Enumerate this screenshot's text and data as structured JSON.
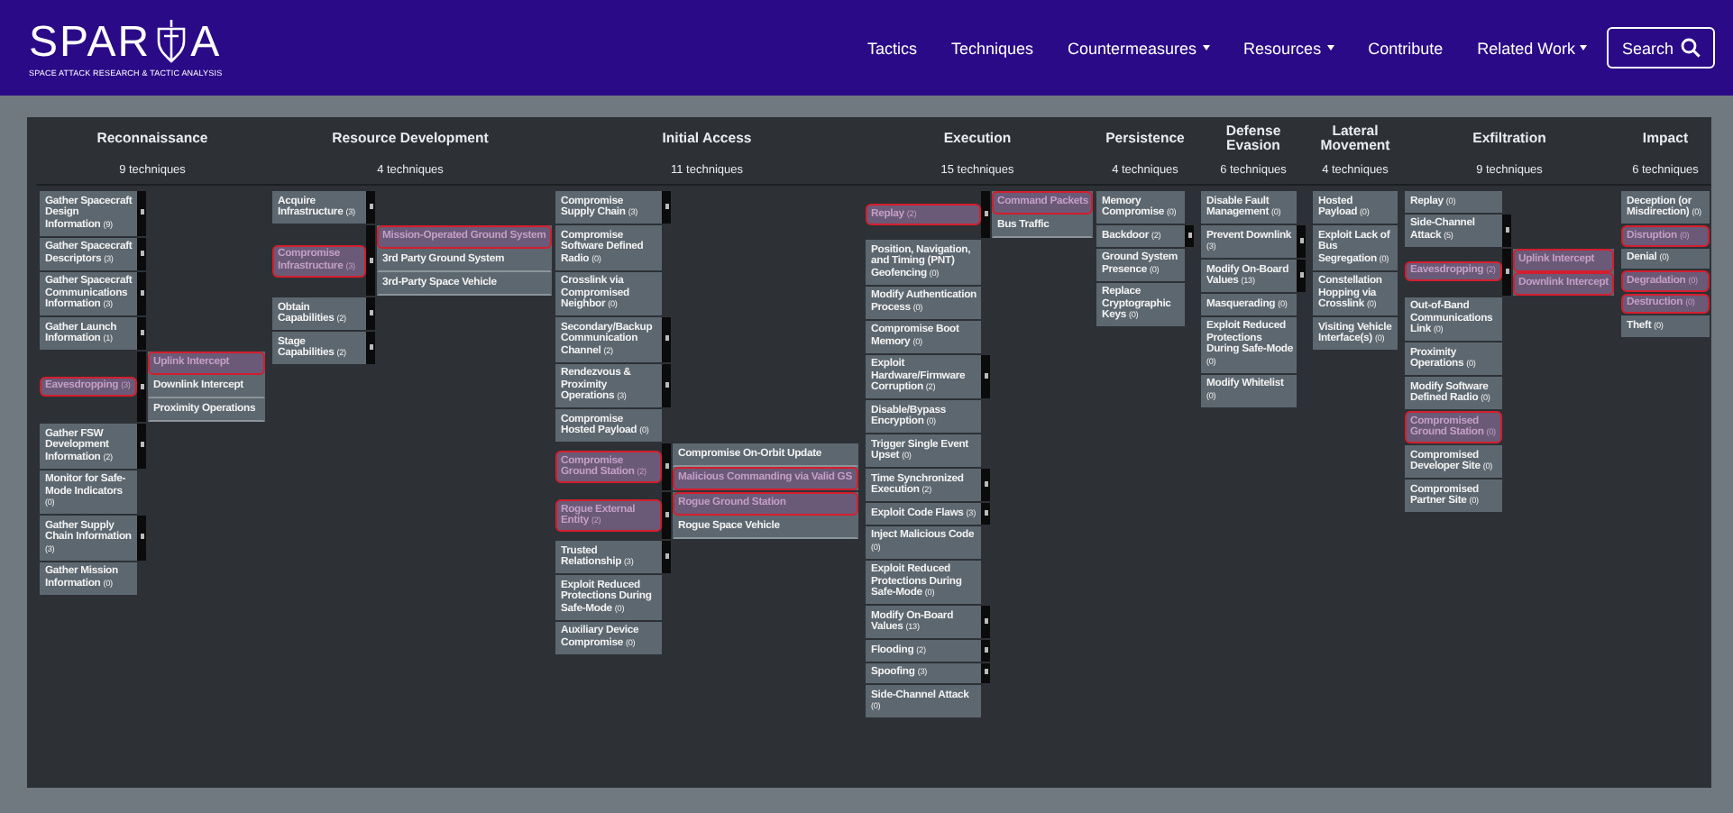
{
  "header": {
    "logo": {
      "wordmark_left": "SPAR",
      "wordmark_right": "A",
      "tagline": "SPACE ATTACK RESEARCH & TACTIC ANALYSIS"
    },
    "nav": [
      {
        "label": "Tactics",
        "has_menu": false
      },
      {
        "label": "Techniques",
        "has_menu": false
      },
      {
        "label": "Countermeasures",
        "has_menu": true
      },
      {
        "label": "Resources",
        "has_menu": true
      },
      {
        "label": "Contribute",
        "has_menu": false
      },
      {
        "label": "Related Work",
        "has_menu": true
      }
    ],
    "search_button": {
      "label": "Search"
    }
  },
  "tactics": [
    {
      "name": "Reconnaissance",
      "count": "9 techniques",
      "techniques": [
        {
          "name": "Gather Spacecraft Design Information",
          "count": "(9)",
          "has_subs": true,
          "highlighted": false
        },
        {
          "name": "Gather Spacecraft Descriptors",
          "count": "(3)",
          "has_subs": true,
          "highlighted": false
        },
        {
          "name": "Gather Spacecraft Communications Information",
          "count": "(3)",
          "has_subs": true,
          "highlighted": false
        },
        {
          "name": "Gather Launch Information",
          "count": "(1)",
          "has_subs": true,
          "highlighted": false
        },
        {
          "name": "Eavesdropping",
          "count": "(3)",
          "has_subs": true,
          "highlighted": true,
          "subtechniques": [
            {
              "name": "Uplink Intercept",
              "highlighted": true
            },
            {
              "name": "Downlink Intercept",
              "highlighted": false
            },
            {
              "name": "Proximity Operations",
              "highlighted": false
            }
          ]
        },
        {
          "name": "Gather FSW Development Information",
          "count": "(2)",
          "has_subs": true,
          "highlighted": false
        },
        {
          "name": "Monitor for Safe-Mode Indicators",
          "count": "(0)",
          "has_subs": false,
          "highlighted": false
        },
        {
          "name": "Gather Supply Chain Information",
          "count": "(3)",
          "has_subs": true,
          "highlighted": false
        },
        {
          "name": "Gather Mission Information",
          "count": "(0)",
          "has_subs": false,
          "highlighted": false
        }
      ]
    },
    {
      "name": "Resource Development",
      "count": "4 techniques",
      "techniques": [
        {
          "name": "Acquire Infrastructure",
          "count": "(3)",
          "has_subs": true,
          "highlighted": false
        },
        {
          "name": "Compromise Infrastructure",
          "count": "(3)",
          "has_subs": true,
          "highlighted": true,
          "subtechniques": [
            {
              "name": "Mission-Operated Ground System",
              "highlighted": true
            },
            {
              "name": "3rd Party Ground System",
              "highlighted": false
            },
            {
              "name": "3rd-Party Space Vehicle",
              "highlighted": false
            }
          ]
        },
        {
          "name": "Obtain Capabilities",
          "count": "(2)",
          "has_subs": true,
          "highlighted": false
        },
        {
          "name": "Stage Capabilities",
          "count": "(2)",
          "has_subs": true,
          "highlighted": false
        }
      ]
    },
    {
      "name": "Initial Access",
      "count": "11 techniques",
      "techniques": [
        {
          "name": "Compromise Supply Chain",
          "count": "(3)",
          "has_subs": true,
          "highlighted": false
        },
        {
          "name": "Compromise Software Defined Radio",
          "count": "(0)",
          "has_subs": false,
          "highlighted": false
        },
        {
          "name": "Crosslink via Compromised Neighbor",
          "count": "(0)",
          "has_subs": false,
          "highlighted": false
        },
        {
          "name": "Secondary/Backup Communication Channel",
          "count": "(2)",
          "has_subs": true,
          "highlighted": false
        },
        {
          "name": "Rendezvous & Proximity Operations",
          "count": "(3)",
          "has_subs": true,
          "highlighted": false
        },
        {
          "name": "Compromise Hosted Payload",
          "count": "(0)",
          "has_subs": false,
          "highlighted": false
        },
        {
          "name": "Compromise Ground Station",
          "count": "(2)",
          "has_subs": true,
          "highlighted": true,
          "subtechniques": [
            {
              "name": "Compromise On-Orbit Update",
              "highlighted": false
            },
            {
              "name": "Malicious Commanding via Valid GS",
              "highlighted": true
            }
          ]
        },
        {
          "name": "Rogue External Entity",
          "count": "(2)",
          "has_subs": true,
          "highlighted": true,
          "subtechniques": [
            {
              "name": "Rogue Ground Station",
              "highlighted": true
            },
            {
              "name": "Rogue Space Vehicle",
              "highlighted": false
            }
          ]
        },
        {
          "name": "Trusted Relationship",
          "count": "(3)",
          "has_subs": true,
          "highlighted": false
        },
        {
          "name": "Exploit Reduced Protections During Safe-Mode",
          "count": "(0)",
          "has_subs": false,
          "highlighted": false
        },
        {
          "name": "Auxiliary Device Compromise",
          "count": "(0)",
          "has_subs": false,
          "highlighted": false
        }
      ]
    },
    {
      "name": "Execution",
      "count": "15 techniques",
      "techniques": [
        {
          "name": "Replay",
          "count": "(2)",
          "has_subs": true,
          "highlighted": true,
          "subtechniques": [
            {
              "name": "Command Packets",
              "highlighted": true
            },
            {
              "name": "Bus Traffic",
              "highlighted": false
            }
          ]
        },
        {
          "name": "Position, Navigation, and Timing (PNT) Geofencing",
          "count": "(0)",
          "has_subs": false,
          "highlighted": false
        },
        {
          "name": "Modify Authentication Process",
          "count": "(0)",
          "has_subs": false,
          "highlighted": false
        },
        {
          "name": "Compromise Boot Memory",
          "count": "(0)",
          "has_subs": false,
          "highlighted": false
        },
        {
          "name": "Exploit Hardware/Firmware Corruption",
          "count": "(2)",
          "has_subs": true,
          "highlighted": false
        },
        {
          "name": "Disable/Bypass Encryption",
          "count": "(0)",
          "has_subs": false,
          "highlighted": false
        },
        {
          "name": "Trigger Single Event Upset",
          "count": "(0)",
          "has_subs": false,
          "highlighted": false
        },
        {
          "name": "Time Synchronized Execution",
          "count": "(2)",
          "has_subs": true,
          "highlighted": false
        },
        {
          "name": "Exploit Code Flaws",
          "count": "(3)",
          "has_subs": true,
          "highlighted": false
        },
        {
          "name": "Inject Malicious Code",
          "count": "(0)",
          "has_subs": false,
          "highlighted": false
        },
        {
          "name": "Exploit Reduced Protections During Safe-Mode",
          "count": "(0)",
          "has_subs": false,
          "highlighted": false
        },
        {
          "name": "Modify On-Board Values",
          "count": "(13)",
          "has_subs": true,
          "highlighted": false
        },
        {
          "name": "Flooding",
          "count": "(2)",
          "has_subs": true,
          "highlighted": false
        },
        {
          "name": "Spoofing",
          "count": "(3)",
          "has_subs": true,
          "highlighted": false
        },
        {
          "name": "Side-Channel Attack",
          "count": "(0)",
          "has_subs": false,
          "highlighted": false
        }
      ]
    },
    {
      "name": "Persistence",
      "count": "4 techniques",
      "techniques": [
        {
          "name": "Memory Compromise",
          "count": "(0)",
          "has_subs": false,
          "highlighted": false
        },
        {
          "name": "Backdoor",
          "count": "(2)",
          "has_subs": true,
          "highlighted": false
        },
        {
          "name": "Ground System Presence",
          "count": "(0)",
          "has_subs": false,
          "highlighted": false
        },
        {
          "name": "Replace Cryptographic Keys",
          "count": "(0)",
          "has_subs": false,
          "highlighted": false
        }
      ]
    },
    {
      "name": "Defense Evasion",
      "count": "6 techniques",
      "techniques": [
        {
          "name": "Disable Fault Management",
          "count": "(0)",
          "has_subs": false,
          "highlighted": false
        },
        {
          "name": "Prevent Downlink",
          "count": "(3)",
          "has_subs": true,
          "highlighted": false
        },
        {
          "name": "Modify On-Board Values",
          "count": "(13)",
          "has_subs": true,
          "highlighted": false
        },
        {
          "name": "Masquerading",
          "count": "(0)",
          "has_subs": false,
          "highlighted": false
        },
        {
          "name": "Exploit Reduced Protections During Safe-Mode",
          "count": "(0)",
          "has_subs": false,
          "highlighted": false
        },
        {
          "name": "Modify Whitelist",
          "count": "(0)",
          "has_subs": false,
          "highlighted": false
        }
      ]
    },
    {
      "name": "Lateral Movement",
      "count": "4 techniques",
      "techniques": [
        {
          "name": "Hosted Payload",
          "count": "(0)",
          "has_subs": false,
          "highlighted": false
        },
        {
          "name": "Exploit Lack of Bus Segregation",
          "count": "(0)",
          "has_subs": false,
          "highlighted": false
        },
        {
          "name": "Constellation Hopping via Crosslink",
          "count": "(0)",
          "has_subs": false,
          "highlighted": false
        },
        {
          "name": "Visiting Vehicle Interface(s)",
          "count": "(0)",
          "has_subs": false,
          "highlighted": false
        }
      ]
    },
    {
      "name": "Exfiltration",
      "count": "9 techniques",
      "techniques": [
        {
          "name": "Replay",
          "count": "(0)",
          "has_subs": false,
          "highlighted": false
        },
        {
          "name": "Side-Channel Attack",
          "count": "(5)",
          "has_subs": true,
          "highlighted": false
        },
        {
          "name": "Eavesdropping",
          "count": "(2)",
          "has_subs": true,
          "highlighted": true,
          "subtechniques": [
            {
              "name": "Uplink Intercept",
              "highlighted": true
            },
            {
              "name": "Downlink Intercept",
              "highlighted": true
            }
          ]
        },
        {
          "name": "Out-of-Band Communications Link",
          "count": "(0)",
          "has_subs": false,
          "highlighted": false
        },
        {
          "name": "Proximity Operations",
          "count": "(0)",
          "has_subs": false,
          "highlighted": false
        },
        {
          "name": "Modify Software Defined Radio",
          "count": "(0)",
          "has_subs": false,
          "highlighted": false
        },
        {
          "name": "Compromised Ground Station",
          "count": "(0)",
          "has_subs": false,
          "highlighted": true
        },
        {
          "name": "Compromised Developer Site",
          "count": "(0)",
          "has_subs": false,
          "highlighted": false
        },
        {
          "name": "Compromised Partner Site",
          "count": "(0)",
          "has_subs": false,
          "highlighted": false
        }
      ]
    },
    {
      "name": "Impact",
      "count": "6 techniques",
      "techniques": [
        {
          "name": "Deception (or Misdirection)",
          "count": "(0)",
          "has_subs": false,
          "highlighted": false
        },
        {
          "name": "Disruption",
          "count": "(0)",
          "has_subs": false,
          "highlighted": true
        },
        {
          "name": "Denial",
          "count": "(0)",
          "has_subs": false,
          "highlighted": false
        },
        {
          "name": "Degradation",
          "count": "(0)",
          "has_subs": false,
          "highlighted": true
        },
        {
          "name": "Destruction",
          "count": "(0)",
          "has_subs": false,
          "highlighted": true
        },
        {
          "name": "Theft",
          "count": "(0)",
          "has_subs": false,
          "highlighted": false
        }
      ]
    }
  ]
}
